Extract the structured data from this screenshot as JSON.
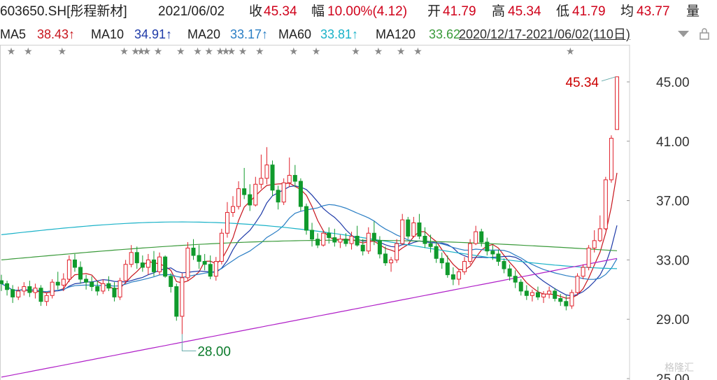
{
  "header": {
    "symbol": "603650.SH[彤程新材]",
    "date": "2021/06/02",
    "close_label": "收",
    "close": "45.34",
    "change_label": "幅",
    "change": "10.00%(4.12)",
    "open_label": "开",
    "open": "41.79",
    "high_label": "高",
    "high": "45.34",
    "low_label": "低",
    "low": "41.79",
    "avg_label": "均",
    "avg": "43.77",
    "vol_label": "量"
  },
  "ma_bar": {
    "ma5_label": "MA5",
    "ma5": "38.43↑",
    "ma10_label": "MA10",
    "ma10": "34.91↑",
    "ma20_label": "MA20",
    "ma20": "33.17↑",
    "ma60_label": "MA60",
    "ma60": "33.81↑",
    "ma120_label": "MA120",
    "ma120": "33.62",
    "range": "2020/12/17-2021/06/02(110日)"
  },
  "watermark": "格隆汇",
  "colors": {
    "up": "#e0202a",
    "down": "#109a2c",
    "ma5": "#c8151d",
    "ma10": "#1e3aa8",
    "ma20": "#2a7ec4",
    "ma60": "#1ab2c8",
    "ma120": "#3a9a3a",
    "ma250": "#b020c8"
  },
  "chart_data": {
    "type": "candlestick",
    "ylim": [
      25,
      47
    ],
    "yticks": [
      "45.00",
      "41.00",
      "37.00",
      "33.00",
      "29.00",
      "25.00"
    ],
    "annotations": [
      {
        "text": "45.34",
        "type": "high"
      },
      {
        "text": "28.00",
        "type": "low"
      }
    ],
    "candles": [
      [
        31.6,
        32.0,
        30.9,
        31.4
      ],
      [
        31.4,
        31.6,
        30.6,
        31.0
      ],
      [
        31.0,
        31.3,
        30.1,
        30.5
      ],
      [
        30.5,
        31.2,
        30.3,
        30.9
      ],
      [
        30.9,
        31.5,
        30.6,
        31.2
      ],
      [
        31.2,
        31.6,
        30.5,
        30.8
      ],
      [
        30.8,
        31.4,
        30.4,
        31.1
      ],
      [
        31.1,
        31.3,
        29.9,
        30.2
      ],
      [
        30.2,
        30.8,
        29.9,
        30.6
      ],
      [
        30.6,
        31.7,
        30.4,
        31.5
      ],
      [
        31.5,
        32.2,
        31.0,
        31.3
      ],
      [
        31.3,
        32.1,
        30.9,
        31.7
      ],
      [
        31.7,
        33.3,
        31.5,
        33.0
      ],
      [
        33.0,
        33.4,
        32.2,
        32.5
      ],
      [
        32.5,
        32.9,
        31.4,
        31.7
      ],
      [
        31.7,
        32.0,
        31.0,
        31.5
      ],
      [
        31.5,
        31.9,
        30.9,
        31.2
      ],
      [
        31.2,
        31.6,
        30.6,
        30.9
      ],
      [
        30.9,
        31.7,
        30.7,
        31.4
      ],
      [
        31.4,
        31.9,
        30.9,
        31.1
      ],
      [
        31.1,
        31.5,
        30.2,
        30.5
      ],
      [
        30.5,
        31.8,
        30.3,
        31.6
      ],
      [
        31.6,
        33.0,
        31.4,
        32.7
      ],
      [
        32.7,
        34.0,
        32.5,
        33.5
      ],
      [
        33.5,
        33.9,
        32.4,
        32.8
      ],
      [
        32.8,
        33.3,
        32.2,
        32.5
      ],
      [
        32.5,
        33.4,
        32.0,
        33.0
      ],
      [
        33.0,
        33.6,
        31.9,
        32.2
      ],
      [
        32.2,
        33.5,
        32.0,
        33.2
      ],
      [
        33.2,
        33.3,
        31.8,
        31.9
      ],
      [
        31.9,
        32.1,
        30.8,
        31.2
      ],
      [
        31.2,
        31.4,
        28.9,
        29.2
      ],
      [
        29.2,
        32.1,
        28.0,
        31.8
      ],
      [
        31.8,
        34.2,
        31.6,
        33.8
      ],
      [
        33.8,
        34.4,
        33.0,
        33.3
      ],
      [
        33.3,
        34.0,
        32.4,
        32.9
      ],
      [
        32.9,
        33.4,
        32.3,
        32.7
      ],
      [
        32.7,
        33.3,
        31.7,
        31.9
      ],
      [
        31.9,
        33.2,
        31.6,
        32.9
      ],
      [
        32.9,
        35.1,
        32.7,
        34.8
      ],
      [
        34.8,
        36.9,
        34.5,
        36.2
      ],
      [
        36.2,
        37.3,
        35.9,
        36.6
      ],
      [
        36.6,
        38.3,
        36.4,
        37.8
      ],
      [
        37.8,
        39.2,
        37.1,
        37.4
      ],
      [
        37.4,
        38.1,
        36.3,
        36.7
      ],
      [
        36.7,
        38.6,
        36.6,
        38.1
      ],
      [
        38.1,
        40.1,
        37.8,
        38.5
      ],
      [
        38.5,
        40.6,
        38.1,
        39.4
      ],
      [
        39.4,
        39.7,
        37.3,
        37.7
      ],
      [
        37.7,
        38.0,
        36.4,
        36.9
      ],
      [
        36.9,
        38.5,
        36.7,
        38.2
      ],
      [
        38.2,
        39.9,
        37.9,
        38.7
      ],
      [
        38.7,
        39.4,
        37.9,
        38.3
      ],
      [
        38.3,
        38.5,
        36.3,
        36.6
      ],
      [
        36.6,
        36.8,
        34.7,
        35.0
      ],
      [
        35.0,
        35.5,
        33.9,
        34.4
      ],
      [
        34.4,
        34.8,
        33.8,
        34.0
      ],
      [
        34.0,
        35.0,
        33.9,
        34.8
      ],
      [
        34.8,
        35.2,
        34.1,
        34.5
      ],
      [
        34.5,
        35.1,
        33.9,
        34.2
      ],
      [
        34.2,
        34.7,
        33.8,
        34.4
      ],
      [
        34.4,
        34.8,
        33.9,
        34.1
      ],
      [
        34.1,
        34.9,
        33.7,
        34.6
      ],
      [
        34.6,
        35.3,
        33.9,
        34.0
      ],
      [
        34.0,
        34.4,
        33.3,
        33.6
      ],
      [
        33.6,
        35.2,
        33.4,
        34.8
      ],
      [
        34.8,
        35.6,
        34.0,
        34.3
      ],
      [
        34.3,
        34.6,
        33.1,
        33.4
      ],
      [
        33.4,
        33.9,
        32.6,
        32.8
      ],
      [
        32.8,
        33.2,
        32.2,
        33.0
      ],
      [
        33.0,
        34.4,
        32.8,
        34.1
      ],
      [
        34.1,
        36.1,
        34.0,
        35.7
      ],
      [
        35.7,
        35.9,
        34.4,
        34.6
      ],
      [
        34.6,
        35.9,
        34.5,
        35.5
      ],
      [
        35.5,
        36.1,
        34.4,
        34.6
      ],
      [
        34.6,
        35.2,
        33.8,
        34.1
      ],
      [
        34.1,
        34.7,
        33.5,
        33.9
      ],
      [
        33.9,
        34.2,
        32.8,
        33.1
      ],
      [
        33.1,
        33.5,
        32.4,
        32.8
      ],
      [
        32.8,
        33.3,
        31.8,
        32.0
      ],
      [
        32.0,
        32.5,
        31.3,
        31.7
      ],
      [
        31.7,
        32.4,
        31.3,
        32.2
      ],
      [
        32.2,
        33.2,
        32.0,
        32.9
      ],
      [
        32.9,
        34.4,
        32.7,
        34.1
      ],
      [
        34.1,
        35.3,
        34.0,
        34.9
      ],
      [
        34.9,
        35.1,
        33.9,
        34.2
      ],
      [
        34.2,
        34.5,
        33.3,
        33.6
      ],
      [
        33.6,
        34.0,
        33.0,
        33.4
      ],
      [
        33.4,
        33.7,
        32.6,
        32.9
      ],
      [
        32.9,
        33.1,
        32.1,
        32.4
      ],
      [
        32.4,
        32.7,
        31.6,
        31.9
      ],
      [
        31.9,
        32.3,
        31.1,
        31.5
      ],
      [
        31.5,
        31.7,
        30.6,
        30.9
      ],
      [
        30.9,
        31.3,
        30.3,
        30.6
      ],
      [
        30.6,
        31.0,
        30.2,
        30.8
      ],
      [
        30.8,
        31.2,
        30.3,
        30.5
      ],
      [
        30.5,
        30.9,
        30.1,
        30.7
      ],
      [
        30.7,
        31.2,
        30.4,
        30.9
      ],
      [
        30.9,
        31.1,
        30.2,
        30.4
      ],
      [
        30.4,
        30.7,
        29.9,
        30.2
      ],
      [
        30.2,
        30.6,
        29.6,
        29.9
      ],
      [
        29.9,
        31.0,
        29.7,
        30.8
      ],
      [
        30.8,
        32.1,
        30.6,
        31.9
      ],
      [
        31.9,
        32.7,
        31.7,
        32.5
      ],
      [
        32.5,
        34.0,
        32.3,
        33.8
      ],
      [
        33.8,
        35.0,
        33.5,
        34.3
      ],
      [
        34.3,
        36.0,
        34.2,
        35.1
      ],
      [
        35.1,
        38.6,
        35.0,
        38.4
      ],
      [
        38.4,
        41.4,
        38.2,
        41.2
      ],
      [
        41.79,
        45.34,
        41.79,
        45.34
      ]
    ],
    "ma5_endpoints": [
      31.2,
      38.43
    ],
    "ma10_endpoints": [
      31.2,
      34.91
    ],
    "ma20_endpoints": [
      30.9,
      33.17
    ],
    "ma60_endpoints": [
      34.9,
      33.81
    ],
    "ma120_endpoints": [
      33.0,
      33.62
    ],
    "ma250_endpoints": [
      25.1,
      33.1
    ],
    "event_stars_idx": [
      1,
      4,
      10,
      21,
      23,
      24,
      25,
      27,
      31,
      34,
      36,
      38,
      39,
      40,
      42,
      45,
      51,
      55,
      62,
      66,
      70,
      73,
      100
    ]
  }
}
